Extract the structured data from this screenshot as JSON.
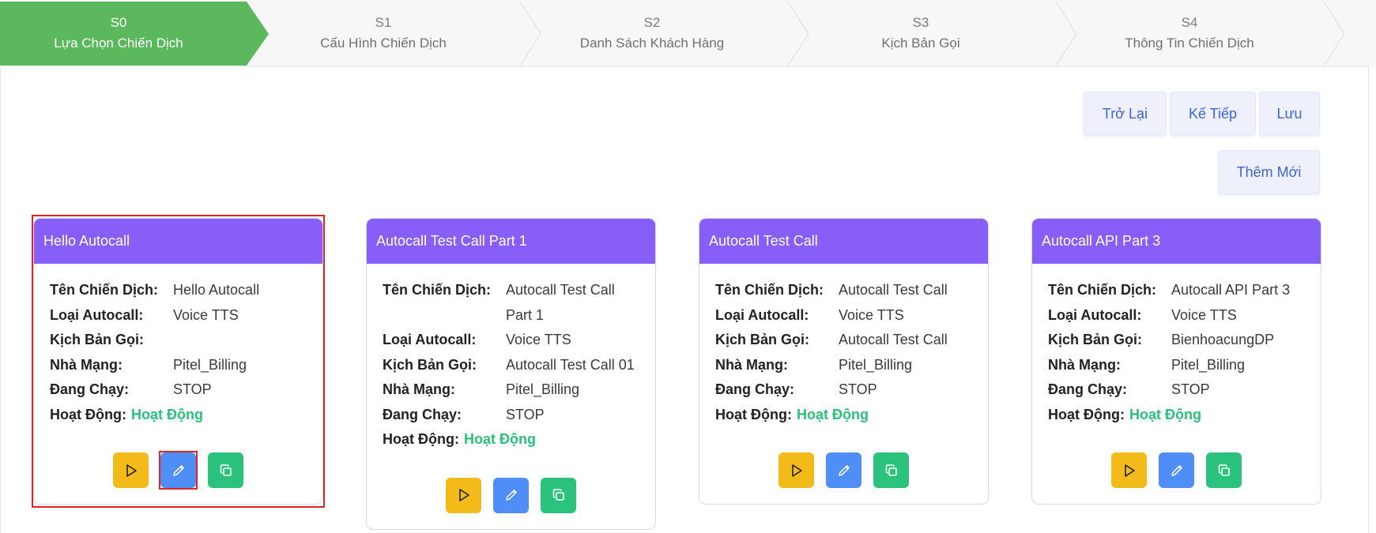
{
  "stepper": {
    "steps": [
      {
        "code": "S0",
        "title": "Lựa Chọn Chiến Dịch",
        "active": true
      },
      {
        "code": "S1",
        "title": "Cấu Hình Chiến Dịch",
        "active": false
      },
      {
        "code": "S2",
        "title": "Danh Sách Khách Hàng",
        "active": false
      },
      {
        "code": "S3",
        "title": "Kịch Bản Gọi",
        "active": false
      },
      {
        "code": "S4",
        "title": "Thông Tin Chiến Dịch",
        "active": false
      }
    ]
  },
  "toolbar": {
    "back_label": "Trở Lại",
    "next_label": "Kế Tiếp",
    "save_label": "Lưu",
    "add_label": "Thêm Mới"
  },
  "field_labels": {
    "name": "Tên Chiến Dịch:",
    "type": "Loại Autocall:",
    "script": "Kịch Bản Gọi:",
    "carrier": "Nhà Mạng:",
    "running": "Đang Chạy:",
    "status": "Hoạt Động:"
  },
  "campaigns": [
    {
      "header": "Hello Autocall",
      "name": "Hello Autocall",
      "type": "Voice TTS",
      "script": "",
      "carrier": "Pitel_Billing",
      "running": "STOP",
      "status": "Hoạt Động"
    },
    {
      "header": "Autocall Test Call Part 1",
      "name": "Autocall Test Call Part 1",
      "type": "Voice TTS",
      "script": "Autocall Test Call 01",
      "carrier": "Pitel_Billing",
      "running": "STOP",
      "status": "Hoạt Động"
    },
    {
      "header": "Autocall Test Call",
      "name": "Autocall Test Call",
      "type": "Voice TTS",
      "script": "Autocall Test Call",
      "carrier": "Pitel_Billing",
      "running": "STOP",
      "status": "Hoạt Động"
    },
    {
      "header": "Autocall API Part 3",
      "name": "Autocall API Part 3",
      "type": "Voice TTS",
      "script": "BienhoacungDP",
      "carrier": "Pitel_Billing",
      "running": "STOP",
      "status": "Hoạt Động"
    }
  ],
  "colors": {
    "step_active": "#5cb85c",
    "card_header": "#875ff8",
    "status_active": "#2bc07a",
    "play_button": "#f2bb1a",
    "edit_button": "#4f8ef7",
    "copy_button": "#2ac27d",
    "highlight": "#e02424"
  },
  "icons": {
    "play": "play-icon",
    "edit": "pencil-icon",
    "copy": "copy-icon"
  },
  "highlighted": {
    "card_index": 0,
    "button": "edit"
  }
}
